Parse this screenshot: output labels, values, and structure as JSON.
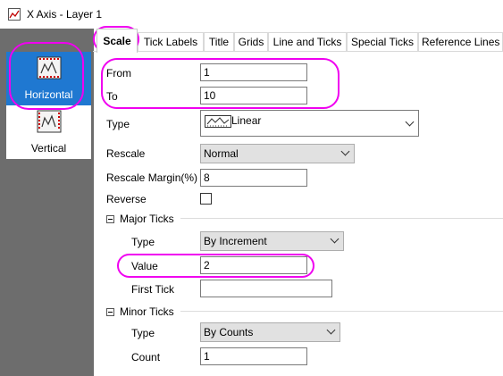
{
  "window": {
    "title": "X Axis - Layer 1"
  },
  "sidebar": {
    "items": [
      {
        "label": "Horizontal",
        "selected": true
      },
      {
        "label": "Vertical",
        "selected": false
      }
    ]
  },
  "tabs": [
    {
      "label": "Scale",
      "active": true
    },
    {
      "label": "Tick Labels"
    },
    {
      "label": "Title"
    },
    {
      "label": "Grids"
    },
    {
      "label": "Line and Ticks"
    },
    {
      "label": "Special Ticks"
    },
    {
      "label": "Reference Lines"
    }
  ],
  "scale": {
    "from_label": "From",
    "from_value": "1",
    "to_label": "To",
    "to_value": "10",
    "type_label": "Type",
    "type_value": "Linear",
    "rescale_label": "Rescale",
    "rescale_value": "Normal",
    "rescale_margin_label": "Rescale Margin(%)",
    "rescale_margin_value": "8",
    "reverse_label": "Reverse",
    "reverse_checked": false
  },
  "major_ticks": {
    "header": "Major Ticks",
    "type_label": "Type",
    "type_value": "By Increment",
    "value_label": "Value",
    "value_value": "2",
    "first_tick_label": "First Tick",
    "first_tick_value": ""
  },
  "minor_ticks": {
    "header": "Minor Ticks",
    "type_label": "Type",
    "type_value": "By Counts",
    "count_label": "Count",
    "count_value": "1"
  },
  "highlight_color": "#f000f0",
  "selection_color": "#1f78d1"
}
